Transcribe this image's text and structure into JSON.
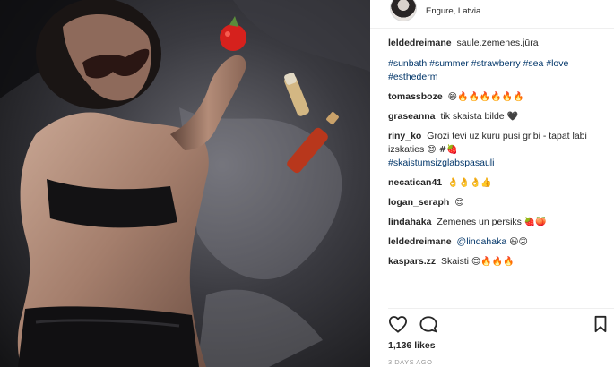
{
  "header": {
    "location": "Engure, Latvia"
  },
  "caption": {
    "username": "leldedreimane",
    "text": "saule.zemenes.jūra",
    "hashtags": "#sunbath #summer #strawberry #sea #love #esthederm"
  },
  "comments": [
    {
      "username": "tomassboze",
      "text": "",
      "emoji": "😁🔥🔥🔥🔥🔥🔥"
    },
    {
      "username": "graseanna",
      "text": "tik skaista bilde",
      "emoji": "🖤"
    },
    {
      "username": "riny_ko",
      "text": "Grozi tevi uz kuru pusi gribi - tapat labi izskaties",
      "emoji": "😊 #🍓",
      "tag": "#skaistumsizglabspasauli"
    },
    {
      "username": "necatican41",
      "text": "",
      "emoji": "👌👌👌👍"
    },
    {
      "username": "logan_seraph",
      "text": "",
      "emoji": "😍"
    },
    {
      "username": "lindahaka",
      "text": "Zemenes un persiks",
      "emoji": "🍓🍑"
    },
    {
      "username": "leldedreimane",
      "text": "",
      "mention": "@lindahaka",
      "emoji": "😃🙃"
    },
    {
      "username": "kaspars.zz",
      "text": "Skaisti",
      "emoji": "😍🔥🔥🔥"
    }
  ],
  "stats": {
    "likes": "1,136 likes",
    "time": "3 DAYS AGO"
  },
  "icons": {
    "heart": "heart-icon",
    "comment": "comment-icon",
    "bookmark": "bookmark-icon"
  },
  "colors": {
    "hashtag": "#003569",
    "text": "#262626",
    "muted": "#999999"
  }
}
